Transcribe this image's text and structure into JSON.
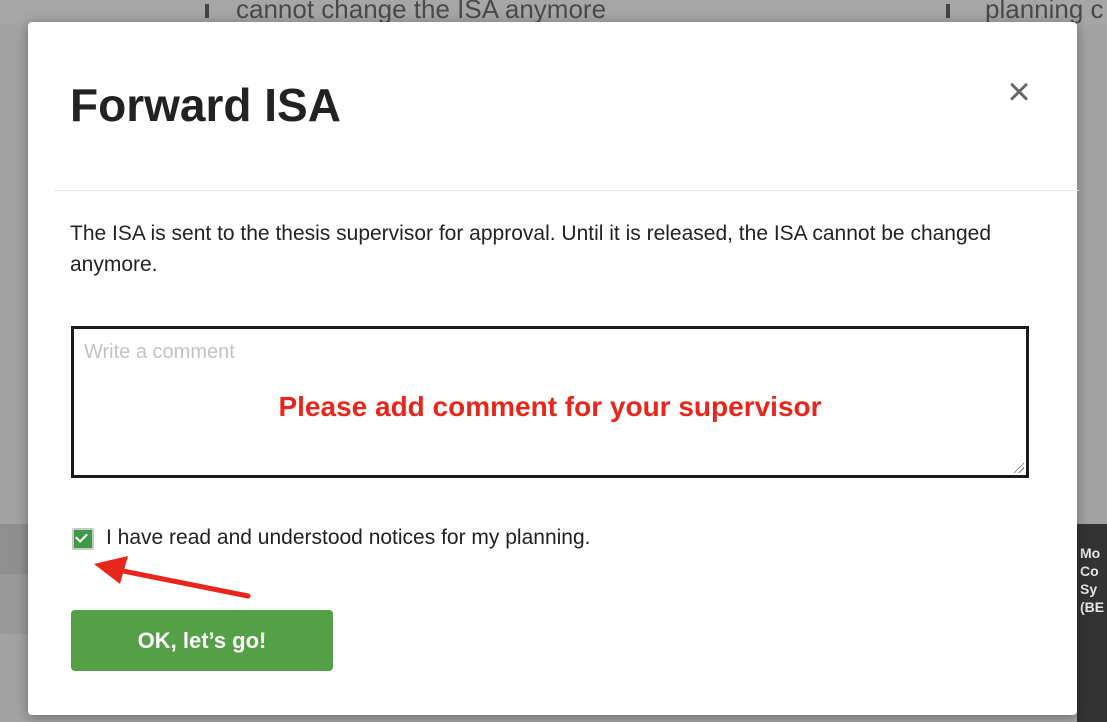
{
  "background": {
    "text_left": "cannot change the ISA anymore",
    "text_right": "planning c",
    "dark_panel_lines": [
      "Mo",
      "Co",
      "Sy",
      "(BE"
    ]
  },
  "modal": {
    "title": "Forward ISA",
    "close_glyph": "×",
    "description": "The ISA is sent to the thesis supervisor for approval. Until it is released, the ISA cannot be changed anymore.",
    "comment": {
      "placeholder": "Write a comment",
      "value": "",
      "annotation": "Please add comment for your supervisor"
    },
    "acknowledge": {
      "label": "I have read and understood notices for my planning.",
      "checked": true
    },
    "ok_button": "OK, let’s go!"
  },
  "colors": {
    "primary_green": "#55a047",
    "checkbox_green": "#3e9a47",
    "annotation_red": "#e8261b"
  },
  "icons": {
    "close": "close-icon",
    "check": "check-icon",
    "arrow": "arrow-annotation-icon"
  }
}
